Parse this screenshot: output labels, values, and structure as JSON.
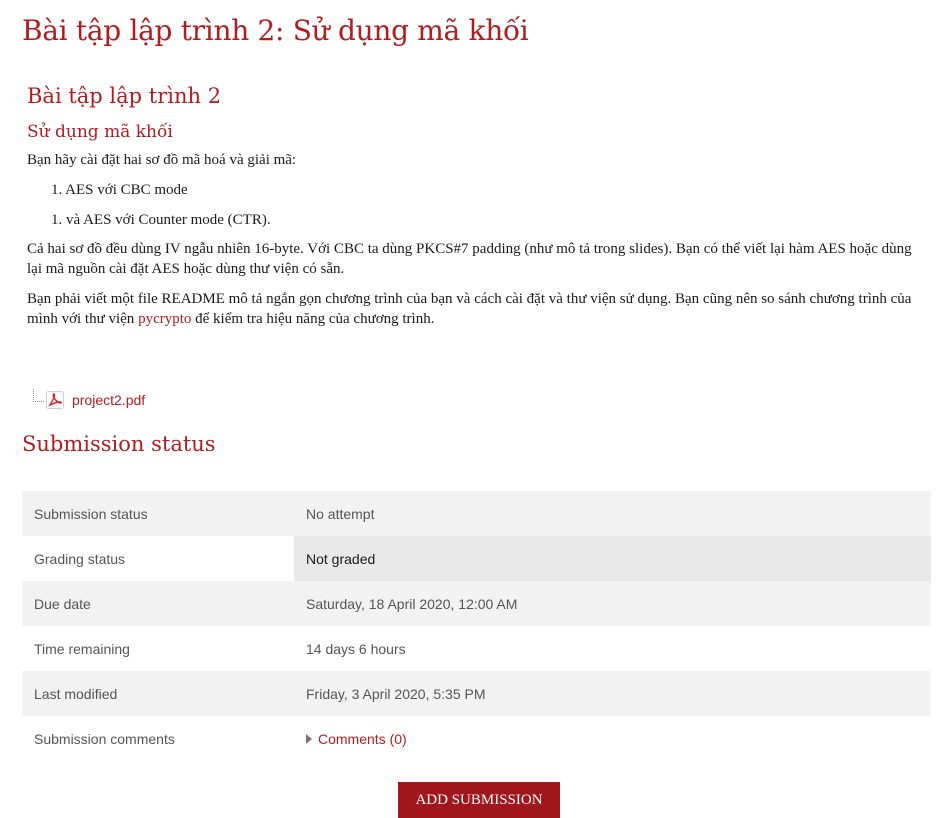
{
  "page": {
    "title": "Bài tập lập trình 2: Sử dụng mã khối"
  },
  "intro": {
    "heading": "Bài tập lập trình 2",
    "subheading": "Sử dụng mã khối",
    "lead": "Bạn hãy cài đặt hai sơ đồ mã hoá và giải mã:",
    "items": [
      "1. AES với CBC mode",
      "1. và AES với Counter mode (CTR)."
    ],
    "para2": "Cả hai sơ đồ đều dùng IV ngẫu nhiên 16-byte. Với CBC ta dùng PKCS#7 padding (như mô tả trong slides). Bạn có thể viết lại hàm AES hoặc dùng lại mã nguồn cài đặt AES hoặc dùng thư viện có sẵn.",
    "para3_before": "Bạn phải viết một file README mô tả ngắn gọn chương trình của bạn và cách cài đặt và thư viện sử dụng. Bạn cũng nên so sánh chương trình của mình với thư viện ",
    "para3_link": "pycrypto",
    "para3_after": " để kiểm tra hiệu năng của chương trình."
  },
  "attachment": {
    "filename": "project2.pdf",
    "icon": "pdf-icon"
  },
  "submission": {
    "title": "Submission status",
    "rows": [
      {
        "label": "Submission status",
        "value": "No attempt"
      },
      {
        "label": "Grading status",
        "value": "Not graded"
      },
      {
        "label": "Due date",
        "value": "Saturday, 18 April 2020, 12:00 AM"
      },
      {
        "label": "Time remaining",
        "value": "14 days 6 hours"
      },
      {
        "label": "Last modified",
        "value": "Friday, 3 April 2020, 5:35 PM"
      },
      {
        "label": "Submission comments",
        "value": "Comments (0)"
      }
    ]
  },
  "actions": {
    "add_submission": "ADD SUBMISSION"
  },
  "colors": {
    "accent": "#b01c20",
    "button": "#a0161c"
  }
}
